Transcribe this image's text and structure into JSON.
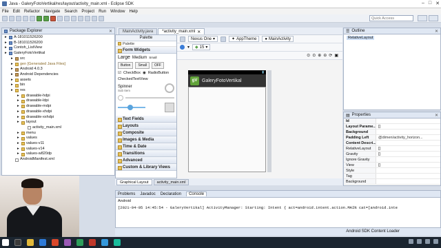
{
  "window": {
    "title": "Java - GaleryFotoVertikal/res/layout/activity_main.xml - Eclipse SDK"
  },
  "menu": [
    "File",
    "Edit",
    "Refactor",
    "Navigate",
    "Search",
    "Project",
    "Run",
    "Window",
    "Help"
  ],
  "quick_access": {
    "placeholder": "Quick Access"
  },
  "package_explorer": {
    "title": "Package Explorer",
    "items": [
      {
        "text": "A-181011526200",
        "level": 0,
        "icon": "proj"
      },
      {
        "text": "B-181011526200",
        "level": 0,
        "icon": "proj"
      },
      {
        "text": "Contoh_ListView",
        "level": 0,
        "icon": "proj"
      },
      {
        "text": "GaleryFotoVertikal",
        "level": 0,
        "icon": "proj"
      },
      {
        "text": "src",
        "level": 1,
        "icon": "pkg"
      },
      {
        "text": "gen [Generated Java Files]",
        "level": 1,
        "icon": "fold",
        "gen": true
      },
      {
        "text": "Android 4.0.3",
        "level": 1,
        "icon": "pkg"
      },
      {
        "text": "Android Dependencies",
        "level": 1,
        "icon": "pkg"
      },
      {
        "text": "assets",
        "level": 1,
        "icon": "fold"
      },
      {
        "text": "bin",
        "level": 1,
        "icon": "fold"
      },
      {
        "text": "res",
        "level": 1,
        "icon": "fold"
      },
      {
        "text": "drawable-hdpi",
        "level": 2,
        "icon": "fold"
      },
      {
        "text": "drawable-ldpi",
        "level": 2,
        "icon": "fold"
      },
      {
        "text": "drawable-mdpi",
        "level": 2,
        "icon": "fold"
      },
      {
        "text": "drawable-xhdpi",
        "level": 2,
        "icon": "fold"
      },
      {
        "text": "drawable-xxhdpi",
        "level": 2,
        "icon": "fold"
      },
      {
        "text": "layout",
        "level": 2,
        "icon": "fold"
      },
      {
        "text": "activity_main.xml",
        "level": 3,
        "icon": "file"
      },
      {
        "text": "menu",
        "level": 2,
        "icon": "fold"
      },
      {
        "text": "values",
        "level": 2,
        "icon": "fold"
      },
      {
        "text": "values-v11",
        "level": 2,
        "icon": "fold"
      },
      {
        "text": "values-v14",
        "level": 2,
        "icon": "fold"
      },
      {
        "text": "values-w820dp",
        "level": 2,
        "icon": "fold"
      },
      {
        "text": "AndroidManifest.xml",
        "level": 1,
        "icon": "file"
      }
    ]
  },
  "editor": {
    "tabs": [
      {
        "label": "MainActivity.java",
        "active": false
      },
      {
        "label": "*activity_main.xml",
        "active": true
      }
    ],
    "palette": {
      "title": "Palette",
      "sub": "Palette",
      "categories_open": "Form Widgets",
      "text_sizes": [
        "Large",
        "Medium",
        "Small"
      ],
      "buttons": [
        "Button",
        "Small",
        "OFF"
      ],
      "checks": [
        "CheckBox",
        "RadioButton"
      ],
      "checked_label": "CheckedTextView",
      "spinner": {
        "label": "Spinner",
        "sub": "Sub Item"
      },
      "categories": [
        "Text Fields",
        "Layouts",
        "Composite",
        "Images & Media",
        "Time & Date",
        "Transitions",
        "Advanced",
        "Custom & Library Views"
      ]
    },
    "canvas": {
      "device": "Nexus One",
      "theme": "AppTheme",
      "activity": "MainActivity",
      "api": "15",
      "app_title": "GaleryFotoVertikal",
      "app_logo": "gV"
    },
    "bottom_tabs": [
      {
        "label": "Graphical Layout",
        "active": true
      },
      {
        "label": "activity_main.xml",
        "active": false
      }
    ]
  },
  "outline": {
    "title": "Outline",
    "item": "RelativeLayout"
  },
  "properties": {
    "title": "Properties",
    "rows": [
      {
        "k": "Id",
        "v": "",
        "bold": true
      },
      {
        "k": "Layout Parame...",
        "v": "[]",
        "bold": true
      },
      {
        "k": "Background",
        "v": "",
        "bold": true
      },
      {
        "k": "Padding Left",
        "v": "@dimen/activity_horizon...",
        "bold": true
      },
      {
        "k": "Content Descri...",
        "v": "",
        "bold": true
      },
      {
        "k": "RelativeLayout",
        "v": "[]",
        "bold": false
      },
      {
        "k": "Gravity",
        "v": "[]",
        "bold": false
      },
      {
        "k": "Ignore Gravity",
        "v": "",
        "bold": false
      },
      {
        "k": "View",
        "v": "[]",
        "bold": false
      },
      {
        "k": "Style",
        "v": "",
        "bold": false
      },
      {
        "k": "Tag",
        "v": "",
        "bold": false
      },
      {
        "k": "Background",
        "v": "",
        "bold": false
      }
    ]
  },
  "console": {
    "tabs": [
      "Problems",
      "Javadoc",
      "Declaration",
      "Console"
    ],
    "label": "Android",
    "line": "[2021-04-05 14:45:54 - GaleryVertikal] ActivityManager: Starting: Intent { act=android.intent.action.MAIN cat=[android.inte"
  },
  "status": {
    "text": "Android SDK Content Loader"
  },
  "colors": {
    "accent": "#dfe7f3",
    "taskbar": "#1b2530"
  }
}
